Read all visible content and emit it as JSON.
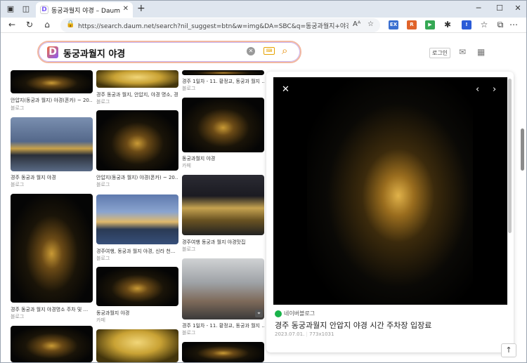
{
  "browser": {
    "tab_title": "동궁과월지 야경 – Daum 검색",
    "url": "https://search.daum.net/search?nil_suggest=btn&w=img&DA=SBC&q=동궁과월지+야경&vimg=63955fj..."
  },
  "search": {
    "query": "동궁과월지 야경",
    "logo_letter": "D"
  },
  "header": {
    "login_label": "로그인"
  },
  "results": [
    {
      "caption": "안압지(동궁과 월지) 야경(폰카) ~ 20...",
      "source": "블로그"
    },
    {
      "caption": "경주 동궁과 월지 야경",
      "source": "블로그"
    },
    {
      "caption": "경주 동궁과 월지 야경명소 주차 및 ...",
      "source": "블로그"
    },
    {
      "caption": "경주 동궁과 월지, 안압지, 야경 명소, 경주 ...",
      "source": "블로그"
    },
    {
      "caption": "안압지(동궁과 월지) 야경(폰카) ~ 20...",
      "source": "블로그"
    },
    {
      "caption": "경주여행, 동궁과 월지 야경, 신라 천...",
      "source": "블로그"
    },
    {
      "caption": "동궁과월지 야경",
      "source": "카페"
    },
    {
      "caption": "경주 1일차 - 11. 황정교, 동궁과 월지 ...",
      "source": "블로그"
    },
    {
      "caption": "동궁과월지 야경",
      "source": "카페"
    },
    {
      "caption": "경주여행 동궁과 월지 야경맛집",
      "source": "블로그"
    },
    {
      "caption": "경주 1일차 - 11. 황정교, 동궁과 월지 ...",
      "source": "블로그"
    }
  ],
  "detail": {
    "source": "네이버블로그",
    "title": "경주 동궁과월지 안압지 야경 시간 주차장 입장료",
    "date": "2023.07.01.",
    "dimensions": "773x1031"
  }
}
